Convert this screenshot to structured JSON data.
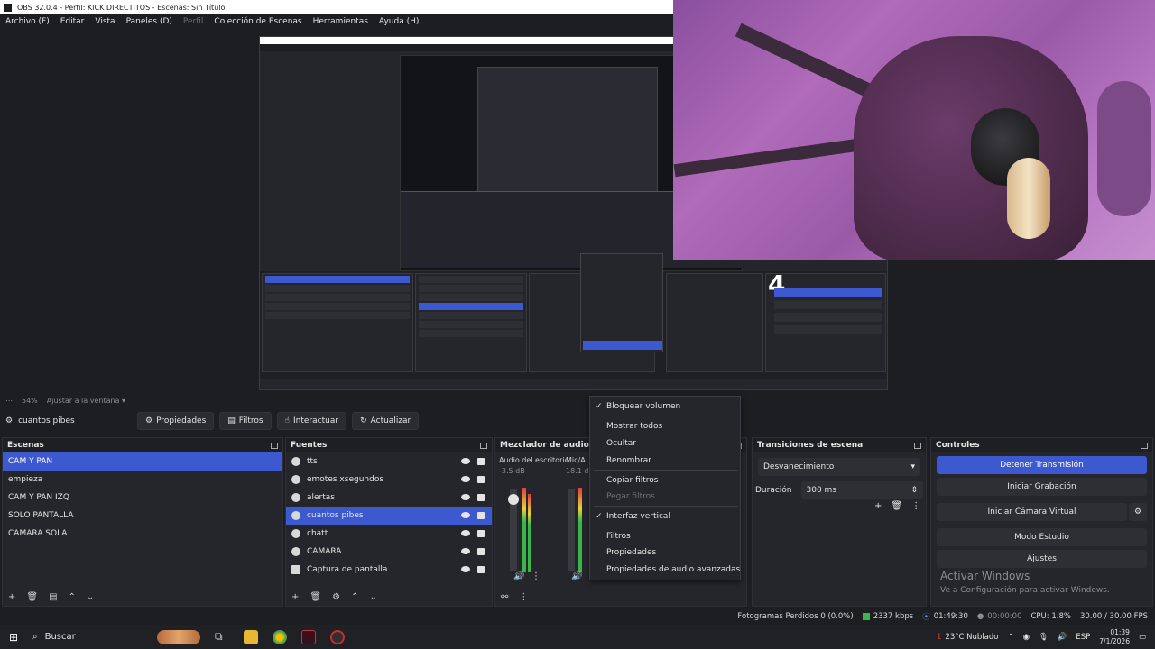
{
  "window": {
    "title": "OBS 32.0.4 - Perfil: KICK DIRECTITOS - Escenas: Sin Título"
  },
  "menu": {
    "items": [
      "Archivo (F)",
      "Editar",
      "Vista",
      "Paneles (D)",
      "Perfil",
      "Colección de Escenas",
      "Herramientas",
      "Ayuda (H)"
    ]
  },
  "preview": {
    "overlay_number": "4",
    "nested_big_number": "4"
  },
  "zoom": {
    "percent": "54%",
    "fit_label": "Ajustar a la ventana"
  },
  "source_toolbar": {
    "current_source": "cuantos pibes",
    "properties": "Propiedades",
    "filters": "Filtros",
    "interact": "Interactuar",
    "refresh": "Actualizar"
  },
  "scenes": {
    "title": "Escenas",
    "items": [
      {
        "label": "CAM Y PAN"
      },
      {
        "label": "empieza"
      },
      {
        "label": "CAM Y PAN IZQ"
      },
      {
        "label": "SOLO PANTALLA"
      },
      {
        "label": "CAMARA SOLA"
      }
    ],
    "selected_index": 0
  },
  "sources": {
    "title": "Fuentes",
    "items": [
      {
        "label": "tts"
      },
      {
        "label": "emotes xsegundos"
      },
      {
        "label": "alertas"
      },
      {
        "label": "cuantos pibes"
      },
      {
        "label": "chatt"
      },
      {
        "label": "CAMARA"
      },
      {
        "label": "Captura de pantalla"
      }
    ],
    "selected_index": 3
  },
  "mixer": {
    "title": "Mezclador de audio",
    "channel1": {
      "name": "Audio del escritorio",
      "level": "-3.5 dB"
    },
    "channel2": {
      "name": "Mic/A",
      "level": "18.1 d"
    }
  },
  "context_menu": {
    "items": [
      {
        "label": "Bloquear volumen",
        "checked": true,
        "disabled": false
      },
      {
        "label": "Mostrar todos",
        "checked": false,
        "disabled": false
      },
      {
        "label": "Ocultar",
        "checked": false,
        "disabled": false
      },
      {
        "label": "Renombrar",
        "checked": false,
        "disabled": false
      },
      {
        "label": "Copiar filtros",
        "checked": false,
        "disabled": false
      },
      {
        "label": "Pegar filtros",
        "checked": false,
        "disabled": true
      },
      {
        "label": "Interfaz vertical",
        "checked": true,
        "disabled": false
      },
      {
        "label": "Filtros",
        "checked": false,
        "disabled": false
      },
      {
        "label": "Propiedades",
        "checked": false,
        "disabled": false
      },
      {
        "label": "Propiedades de audio avanzadas",
        "checked": false,
        "disabled": false
      }
    ],
    "check_glyph": "✓"
  },
  "transitions": {
    "title": "Transiciones de escena",
    "selected": "Desvanecimiento",
    "duration_label": "Duración",
    "duration_value": "300 ms"
  },
  "controls": {
    "title": "Controles",
    "stop_stream": "Detener Transmisión",
    "start_recording": "Iniciar Grabación",
    "start_virtualcam": "Iniciar Cámara Virtual",
    "studio_mode": "Modo Estudio",
    "settings": "Ajustes"
  },
  "watermark": {
    "line1": "Activar Windows",
    "line2": "Ve a Configuración para activar Windows."
  },
  "status": {
    "dropped_frames": "Fotogramas Perdidos 0 (0.0%)",
    "bitrate": "2337 kbps",
    "stream_time": "01:49:30",
    "rec_time": "00:00:00",
    "cpu": "CPU: 1.8%",
    "fps": "30.00 / 30.00 FPS"
  },
  "taskbar": {
    "search": "Buscar",
    "weather": "23°C  Nublado",
    "lang": "ESP",
    "time": "01:39",
    "date": "7/1/2026",
    "weather_badge": "1"
  },
  "colors": {
    "accent": "#3c59d0",
    "meter_green": "#39b54a",
    "meter_yellow": "#e6d23a",
    "meter_red": "#e03c3c"
  }
}
